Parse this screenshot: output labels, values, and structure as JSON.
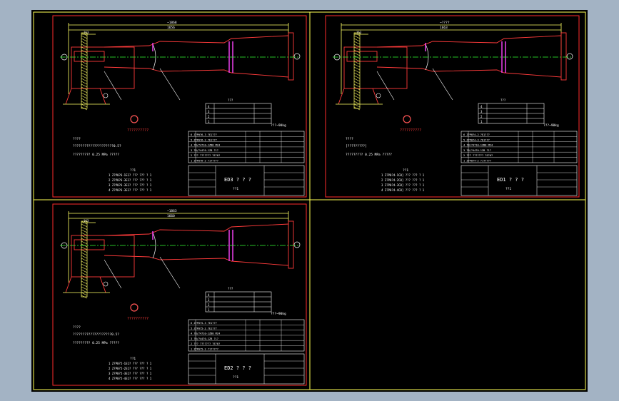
{
  "colors": {
    "background": "#a3b3c4",
    "canvas": "#000000",
    "border": "#ffff55",
    "frame": "#ff2b2b",
    "part": "#ff3b3b",
    "axis": "#33ff33",
    "dim": "#ffff66",
    "text": "#ffffff",
    "flange": "#ff44ff",
    "cyan": "#33ffff"
  },
  "sheets": [
    {
      "code": "ED3",
      "title_q": "? ? ?",
      "sub": "??1",
      "dim_total": "~1868",
      "dim_inner": "1656",
      "dim_small": "163",
      "mass": "???~90kg",
      "logo": "??????????",
      "notes": [
        "????",
        "?????????????????????0.5?",
        "????????? 0.25 MPa ?????"
      ],
      "codes": [
        "??1",
        "Z?P0?6-1E1?",
        "Z?P0?6-3E1?",
        "Z?P0?6-3E1?",
        "Z?P0?6-3E1?"
      ],
      "rows": [
        "6  Z?P0?6-3  ?E1???",
        "5  Z?P0?6-2  ?E1???",
        "4  ?B/?4710-1ZB8  M24",
        "3  ?B/?4470-1ZB  ?1?",
        "2  ???   ???????  ?E?0?",
        "1  Z?P0?6-2  ?1?????"
      ]
    },
    {
      "code": "ED1",
      "title_q": "? ? ?",
      "sub": "??1",
      "dim_total": "~????",
      "dim_inner": "1663",
      "dim_small": "163",
      "mass": "???~90kg",
      "logo": "??????????",
      "notes": [
        "????",
        "[?????????]",
        "????????? 0.25 MPa ?????"
      ],
      "codes": [
        "??1",
        "Z?P0?4-1C0]",
        "Z?P0?4-2C0]",
        "Z?P0?4-3C0]",
        "Z?P0?4-4C0]"
      ],
      "rows": [
        "6  Z?P0?4-2  ?E1???",
        "5  Z?P0?4-3  ?E1???",
        "4  ?B/?4710-1ZB8  M24",
        "3  ?B/?4470-1ZB  ?1?",
        "2  ???   ???????  ?E?0?",
        "1  Z?P0?4-2  ?1?????"
      ]
    },
    {
      "code": "ED2",
      "title_q": "? ? ?",
      "sub": "??1",
      "dim_total": "~1863",
      "dim_inner": "1660",
      "dim_small": "163",
      "mass": "???~90kg",
      "logo": "??????????",
      "notes": [
        "????",
        "????????????????????0.5?",
        "????????? 0.25 MPa ?????"
      ],
      "codes": [
        "??1",
        "Z?P0?5-1E1?",
        "Z?P0?5-2E1?",
        "Z?P0?5-3E1?",
        "Z?P0?5-4E1?"
      ],
      "rows": [
        "6  Z?P0?5-3  ?E1???",
        "5  Z?P0?5-2  ?E1???",
        "4  ?B/?4710-1ZB8  M24",
        "3  ?B/?4470-1ZB  ?1?",
        "2  ???   ???????  ?E?0?",
        "1  Z?P0?5-2  ?1?????"
      ]
    }
  ]
}
